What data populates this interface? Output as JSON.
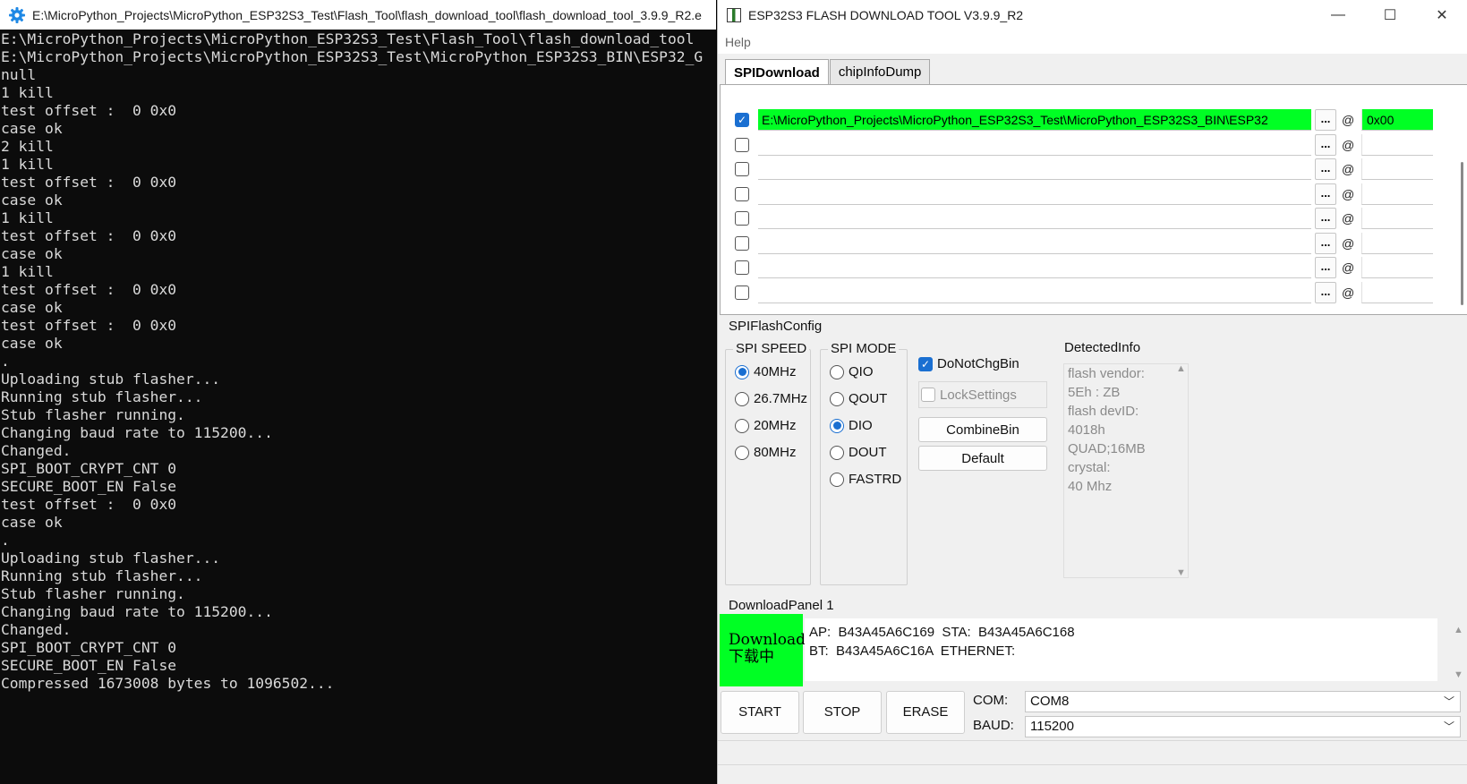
{
  "console": {
    "title": "E:\\MicroPython_Projects\\MicroPython_ESP32S3_Test\\Flash_Tool\\flash_download_tool\\flash_download_tool_3.9.9_R2.e",
    "lines": [
      "E:\\MicroPython_Projects\\MicroPython_ESP32S3_Test\\Flash_Tool\\flash_download_tool",
      "E:\\MicroPython_Projects\\MicroPython_ESP32S3_Test\\MicroPython_ESP32S3_BIN\\ESP32_G",
      "null",
      "1 kill",
      "test offset :  0 0x0",
      "case ok",
      "2 kill",
      "1 kill",
      "test offset :  0 0x0",
      "case ok",
      "1 kill",
      "test offset :  0 0x0",
      "case ok",
      "1 kill",
      "test offset :  0 0x0",
      "case ok",
      "test offset :  0 0x0",
      "case ok",
      ".",
      "Uploading stub flasher...",
      "Running stub flasher...",
      "Stub flasher running.",
      "Changing baud rate to 115200...",
      "Changed.",
      "SPI_BOOT_CRYPT_CNT 0",
      "SECURE_BOOT_EN False",
      "test offset :  0 0x0",
      "case ok",
      ".",
      "Uploading stub flasher...",
      "Running stub flasher...",
      "Stub flasher running.",
      "Changing baud rate to 115200...",
      "Changed.",
      "SPI_BOOT_CRYPT_CNT 0",
      "SECURE_BOOT_EN False",
      "Compressed 1673008 bytes to 1096502..."
    ]
  },
  "tool": {
    "title": "ESP32S3 FLASH DOWNLOAD TOOL V3.9.9_R2",
    "window_controls": {
      "minimize": "—",
      "maximize": "☐",
      "close": "✕"
    },
    "menu": {
      "help": "Help"
    },
    "tabs": {
      "spi_download": "SPIDownload",
      "chip_info_dump": "chipInfoDump"
    },
    "files": [
      {
        "checked": true,
        "path": "E:\\MicroPython_Projects\\MicroPython_ESP32S3_Test\\MicroPython_ESP32S3_BIN\\ESP32",
        "address": "0x00"
      },
      {
        "checked": false,
        "path": "",
        "address": ""
      },
      {
        "checked": false,
        "path": "",
        "address": ""
      },
      {
        "checked": false,
        "path": "",
        "address": ""
      },
      {
        "checked": false,
        "path": "",
        "address": ""
      },
      {
        "checked": false,
        "path": "",
        "address": ""
      },
      {
        "checked": false,
        "path": "",
        "address": ""
      },
      {
        "checked": false,
        "path": "",
        "address": ""
      }
    ],
    "browse_label": "...",
    "at_label": "@",
    "highlight_color": "#00ff24",
    "spi_flash_config": {
      "label": "SPIFlashConfig",
      "spi_speed": {
        "label": "SPI SPEED",
        "options": [
          "40MHz",
          "26.7MHz",
          "20MHz",
          "80MHz"
        ],
        "selected": "40MHz"
      },
      "spi_mode": {
        "label": "SPI MODE",
        "options": [
          "QIO",
          "QOUT",
          "DIO",
          "DOUT",
          "FASTRD"
        ],
        "selected": "DIO"
      },
      "do_not_chg_bin": {
        "label": "DoNotChgBin",
        "checked": true
      },
      "lock_settings": {
        "label": "LockSettings",
        "checked": false
      },
      "combine_bin": "CombineBin",
      "default": "Default",
      "detected_info": {
        "label": "DetectedInfo",
        "text": "flash vendor:\n5Eh : ZB\nflash devID:\n4018h\nQUAD;16MB\ncrystal:\n40 Mhz"
      }
    },
    "download_panel": {
      "label": "DownloadPanel 1",
      "status": "Download\n下载中",
      "log": "AP:  B43A45A6C169  STA:  B43A45A6C168\nBT:  B43A45A6C16A  ETHERNET:",
      "start": "START",
      "stop": "STOP",
      "erase": "ERASE",
      "com_label": "COM:",
      "com_value": "COM8",
      "baud_label": "BAUD:",
      "baud_value": "115200"
    }
  }
}
